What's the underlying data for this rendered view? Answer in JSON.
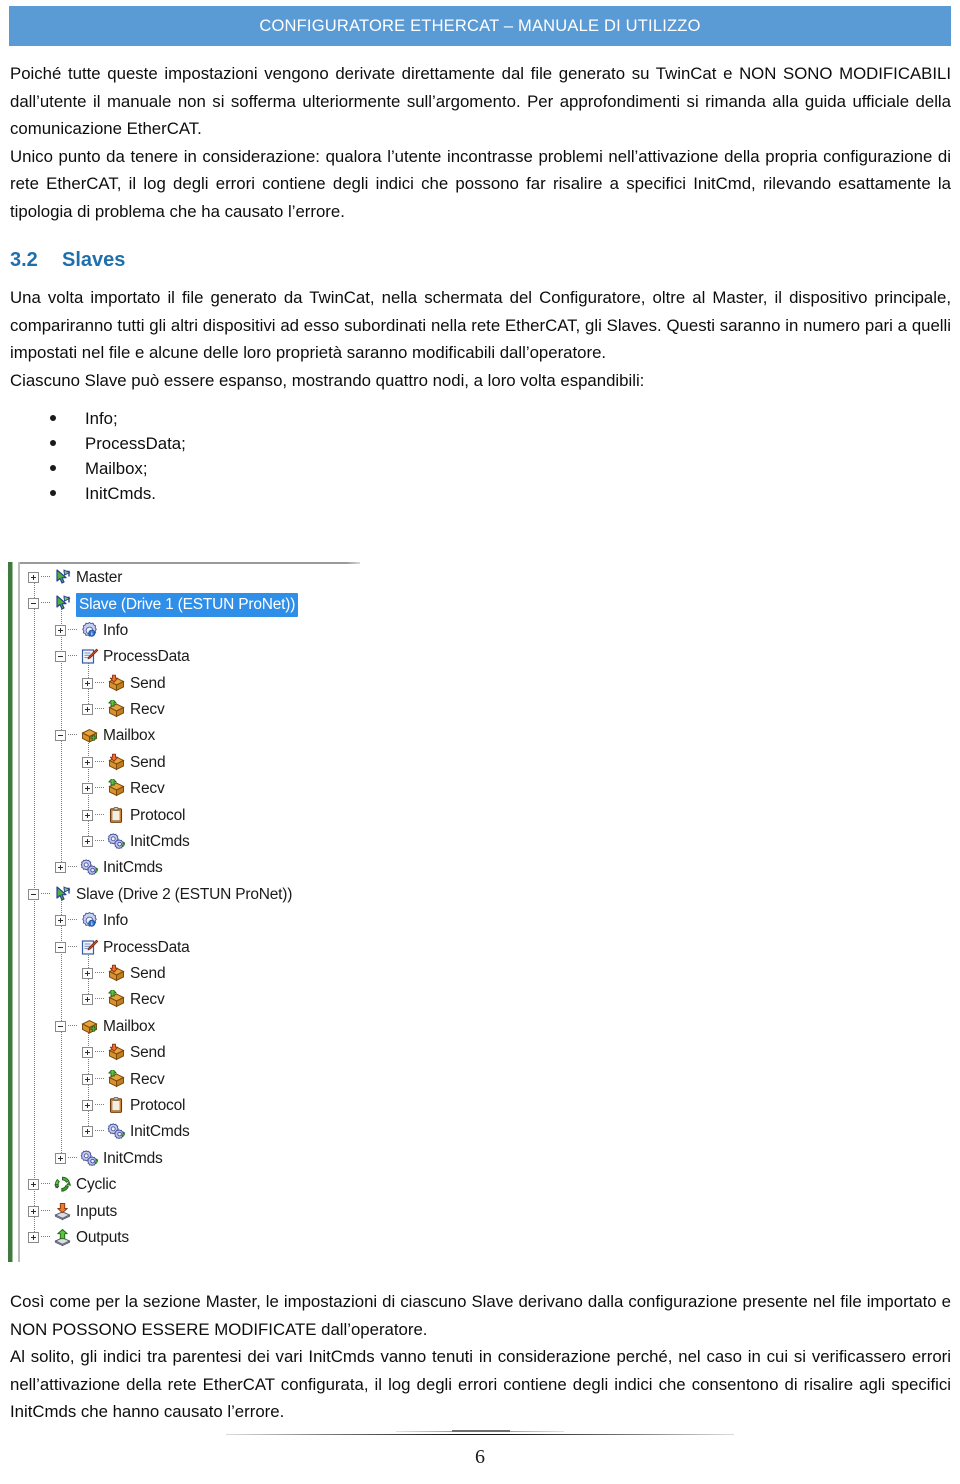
{
  "header": {
    "title": "CONFIGURATORE ETHERCAT – MANUALE DI UTILIZZO",
    "band_color": "#5b9bd5"
  },
  "paragraphs": {
    "p1": "Poiché tutte queste impostazioni vengono derivate direttamente dal file generato su TwinCat e NON SONO MODIFICABILI dall’utente il manuale non si sofferma ulteriormente sull’argomento. Per approfondimenti si rimanda alla guida ufficiale della comunicazione EtherCAT.",
    "p2": "Unico punto da tenere in considerazione: qualora l’utente incontrasse problemi nell’attivazione della propria configurazione di rete EtherCAT, il log degli errori contiene degli indici che possono far risalire a specifici InitCmd, rilevando esattamente la tipologia di problema che ha causato l’errore.",
    "p3": "Una volta importato il file generato da TwinCat, nella schermata del Configuratore, oltre al Master, il dispositivo principale, compariranno tutti gli altri dispositivi ad esso subordinati nella rete EtherCAT, gli Slaves. Questi saranno in numero pari a quelli impostati nel file e alcune delle loro proprietà saranno modificabili dall’operatore.",
    "p4": "Ciascuno Slave può essere espanso, mostrando quattro nodi, a loro volta espandibili:",
    "p5": "Così come per la sezione Master, le impostazioni di ciascuno Slave derivano dalla configurazione presente nel file importato e NON POSSONO ESSERE MODIFICATE dall’operatore.",
    "p6": "Al solito, gli indici tra parentesi dei vari InitCmds vanno tenuti in considerazione perché, nel caso in cui si verificassero errori nell’attivazione della rete EtherCAT configurata, il log degli errori contiene degli indici che consentono di risalire agli specifici InitCmds che hanno causato l’errore."
  },
  "section": {
    "number": "3.2",
    "title": "Slaves",
    "color": "#1f6fad"
  },
  "bullets": [
    {
      "label": "Info;"
    },
    {
      "label": "ProcessData;"
    },
    {
      "label": "Mailbox;"
    },
    {
      "label": "InitCmds."
    }
  ],
  "tree": {
    "selection_color": "#2f8fe8",
    "rows": [
      {
        "label": "Master",
        "depth": 0,
        "expander": "plus",
        "icon": "cursor-arrow-icon",
        "selected": false
      },
      {
        "label": "Slave (Drive 1 (ESTUN ProNet))",
        "depth": 0,
        "expander": "minus",
        "icon": "cursor-arrow-icon",
        "selected": true
      },
      {
        "label": "Info",
        "depth": 1,
        "expander": "plus",
        "icon": "info-gear-icon",
        "selected": false
      },
      {
        "label": "ProcessData",
        "depth": 1,
        "expander": "minus",
        "icon": "edit-note-icon",
        "selected": false
      },
      {
        "label": "Send",
        "depth": 2,
        "expander": "plus",
        "icon": "box-send-icon",
        "selected": false
      },
      {
        "label": "Recv",
        "depth": 2,
        "expander": "plus",
        "icon": "box-recv-icon",
        "selected": false
      },
      {
        "label": "Mailbox",
        "depth": 1,
        "expander": "minus",
        "icon": "box-mailbox-icon",
        "selected": false
      },
      {
        "label": "Send",
        "depth": 2,
        "expander": "plus",
        "icon": "box-send-icon",
        "selected": false
      },
      {
        "label": "Recv",
        "depth": 2,
        "expander": "plus",
        "icon": "box-recv-icon",
        "selected": false
      },
      {
        "label": "Protocol",
        "depth": 2,
        "expander": "plus",
        "icon": "clipboard-icon",
        "selected": false
      },
      {
        "label": "InitCmds",
        "depth": 2,
        "expander": "plus",
        "icon": "gears-icon",
        "selected": false
      },
      {
        "label": "InitCmds",
        "depth": 1,
        "expander": "plus",
        "icon": "gears-icon",
        "selected": false
      },
      {
        "label": "Slave (Drive 2 (ESTUN ProNet))",
        "depth": 0,
        "expander": "minus",
        "icon": "cursor-arrow-icon",
        "selected": false
      },
      {
        "label": "Info",
        "depth": 1,
        "expander": "plus",
        "icon": "info-gear-icon",
        "selected": false
      },
      {
        "label": "ProcessData",
        "depth": 1,
        "expander": "minus",
        "icon": "edit-note-icon",
        "selected": false
      },
      {
        "label": "Send",
        "depth": 2,
        "expander": "plus",
        "icon": "box-send-icon",
        "selected": false
      },
      {
        "label": "Recv",
        "depth": 2,
        "expander": "plus",
        "icon": "box-recv-icon",
        "selected": false
      },
      {
        "label": "Mailbox",
        "depth": 1,
        "expander": "minus",
        "icon": "box-mailbox-icon",
        "selected": false
      },
      {
        "label": "Send",
        "depth": 2,
        "expander": "plus",
        "icon": "box-send-icon",
        "selected": false
      },
      {
        "label": "Recv",
        "depth": 2,
        "expander": "plus",
        "icon": "box-recv-icon",
        "selected": false
      },
      {
        "label": "Protocol",
        "depth": 2,
        "expander": "plus",
        "icon": "clipboard-icon",
        "selected": false
      },
      {
        "label": "InitCmds",
        "depth": 2,
        "expander": "plus",
        "icon": "gears-icon",
        "selected": false
      },
      {
        "label": "InitCmds",
        "depth": 1,
        "expander": "plus",
        "icon": "gears-icon",
        "selected": false
      },
      {
        "label": "Cyclic",
        "depth": 0,
        "expander": "plus",
        "icon": "cyclic-refresh-icon",
        "selected": false
      },
      {
        "label": "Inputs",
        "depth": 0,
        "expander": "plus",
        "icon": "inputs-arrow-icon",
        "selected": false
      },
      {
        "label": "Outputs",
        "depth": 0,
        "expander": "plus",
        "icon": "outputs-arrow-icon",
        "selected": false
      }
    ]
  },
  "footer": {
    "page_number": "6"
  }
}
